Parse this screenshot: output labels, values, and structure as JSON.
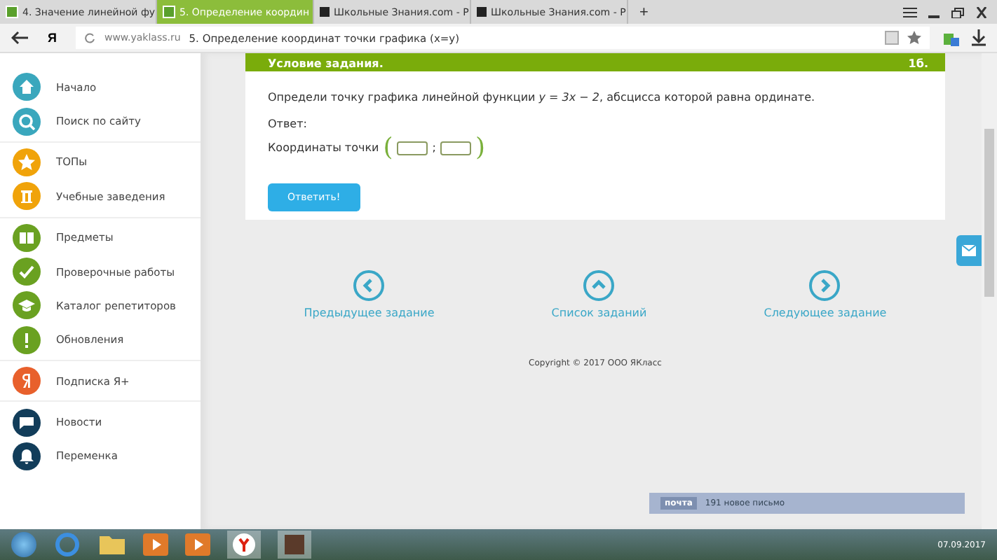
{
  "browser": {
    "tabs": [
      {
        "title": "4. Значение линейной фу",
        "selected": false,
        "kind": "yaklass"
      },
      {
        "title": "5. Определение координ",
        "selected": true,
        "kind": "yaklass"
      },
      {
        "title": "Школьные Знания.com - Р",
        "selected": false,
        "kind": "znanija"
      },
      {
        "title": "Школьные Знания.com - Р",
        "selected": false,
        "kind": "znanija"
      }
    ],
    "new_tab": "+",
    "yandex": "Я",
    "domain": "www.yaklass.ru",
    "page_title": "5. Определение координат точки графика (x=y)"
  },
  "sidebar": {
    "groups": [
      [
        {
          "label": "Начало",
          "color": "#3aa7bd",
          "kind": "home"
        },
        {
          "label": "Поиск по сайту",
          "color": "#3aa7bd",
          "kind": "search"
        }
      ],
      [
        {
          "label": "ТОПы",
          "color": "#f0a30a",
          "kind": "star"
        },
        {
          "label": "Учебные заведения",
          "color": "#f0a30a",
          "kind": "building"
        }
      ],
      [
        {
          "label": "Предметы",
          "color": "#6aa121",
          "kind": "book"
        },
        {
          "label": "Проверочные работы",
          "color": "#6aa121",
          "kind": "check"
        },
        {
          "label": "Каталог репетиторов",
          "color": "#6aa121",
          "kind": "cap"
        },
        {
          "label": "Обновления",
          "color": "#6aa121",
          "kind": "exclaim"
        }
      ],
      [
        {
          "label": "Подписка Я+",
          "color": "#e8602c",
          "kind": "ya"
        }
      ],
      [
        {
          "label": "Новости",
          "color": "#123d5a",
          "kind": "chat"
        },
        {
          "label": "Переменка",
          "color": "#123d5a",
          "kind": "bell"
        }
      ]
    ]
  },
  "task": {
    "header": "Условие задания.",
    "points": "1б.",
    "question": "Определи точку графика линейной функции *y = 3x − 2*, абсцисса которой равна ординате.",
    "answer_label": "Ответ:",
    "coords_label": "Координаты точки",
    "open": "(",
    "sep": ";",
    "close": ")",
    "submit": "Ответить!"
  },
  "nav": [
    {
      "label": "Предыдущее задание",
      "kind": "left"
    },
    {
      "label": "Список заданий",
      "kind": "up"
    },
    {
      "label": "Следующее задание",
      "kind": "right"
    }
  ],
  "copyright": "Copyright © 2017 ООО ЯКласс",
  "notification": {
    "tag": "почта",
    "text": "191 новое письмо"
  },
  "taskbar": {
    "date": "07.09.2017"
  }
}
